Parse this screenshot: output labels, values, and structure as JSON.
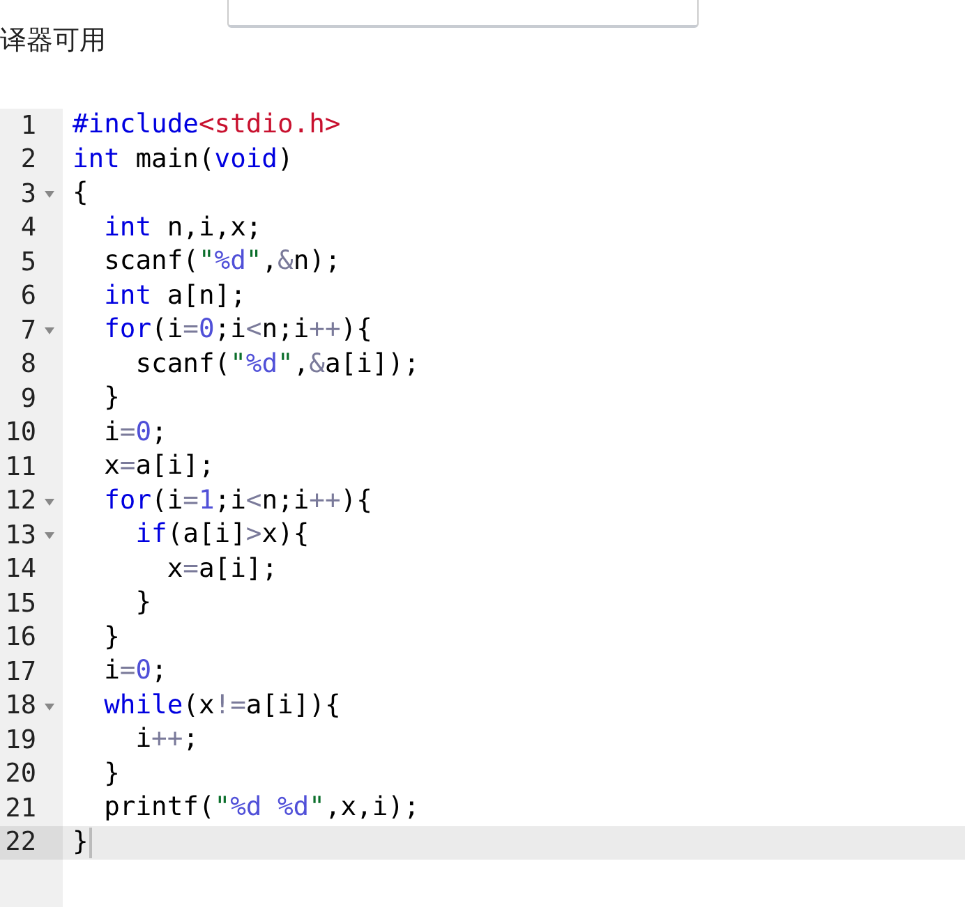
{
  "compiler_note": "译器可用",
  "code_lines": [
    {
      "number": "1",
      "foldable": false,
      "current": false,
      "tokens": [
        {
          "kind": "meta",
          "text": "#include"
        },
        {
          "kind": "header",
          "text": "<stdio.h>"
        }
      ]
    },
    {
      "number": "2",
      "foldable": false,
      "current": false,
      "tokens": [
        {
          "kind": "keyword",
          "text": "int"
        },
        {
          "kind": "plain",
          "text": " main("
        },
        {
          "kind": "keyword",
          "text": "void"
        },
        {
          "kind": "plain",
          "text": ")"
        }
      ]
    },
    {
      "number": "3",
      "foldable": true,
      "current": false,
      "tokens": [
        {
          "kind": "plain",
          "text": "{"
        }
      ]
    },
    {
      "number": "4",
      "foldable": false,
      "current": false,
      "tokens": [
        {
          "kind": "keyword",
          "text": "  int"
        },
        {
          "kind": "plain",
          "text": " n,i,x;"
        }
      ]
    },
    {
      "number": "5",
      "foldable": false,
      "current": false,
      "tokens": [
        {
          "kind": "plain",
          "text": "  scanf("
        },
        {
          "kind": "quote",
          "text": "\""
        },
        {
          "kind": "format",
          "text": "%d"
        },
        {
          "kind": "quote",
          "text": "\""
        },
        {
          "kind": "plain",
          "text": ","
        },
        {
          "kind": "operator",
          "text": "&"
        },
        {
          "kind": "plain",
          "text": "n);"
        }
      ]
    },
    {
      "number": "6",
      "foldable": false,
      "current": false,
      "tokens": [
        {
          "kind": "keyword",
          "text": "  int"
        },
        {
          "kind": "plain",
          "text": " a[n];"
        }
      ]
    },
    {
      "number": "7",
      "foldable": true,
      "current": false,
      "tokens": [
        {
          "kind": "keyword",
          "text": "  for"
        },
        {
          "kind": "plain",
          "text": "(i"
        },
        {
          "kind": "operator",
          "text": "="
        },
        {
          "kind": "number",
          "text": "0"
        },
        {
          "kind": "plain",
          "text": ";i"
        },
        {
          "kind": "operator",
          "text": "<"
        },
        {
          "kind": "plain",
          "text": "n;i"
        },
        {
          "kind": "operator",
          "text": "++"
        },
        {
          "kind": "plain",
          "text": "){"
        }
      ]
    },
    {
      "number": "8",
      "foldable": false,
      "current": false,
      "tokens": [
        {
          "kind": "plain",
          "text": "    scanf("
        },
        {
          "kind": "quote",
          "text": "\""
        },
        {
          "kind": "format",
          "text": "%d"
        },
        {
          "kind": "quote",
          "text": "\""
        },
        {
          "kind": "plain",
          "text": ","
        },
        {
          "kind": "operator",
          "text": "&"
        },
        {
          "kind": "plain",
          "text": "a[i]);"
        }
      ]
    },
    {
      "number": "9",
      "foldable": false,
      "current": false,
      "tokens": [
        {
          "kind": "plain",
          "text": "  }"
        }
      ]
    },
    {
      "number": "10",
      "foldable": false,
      "current": false,
      "tokens": [
        {
          "kind": "plain",
          "text": "  i"
        },
        {
          "kind": "operator",
          "text": "="
        },
        {
          "kind": "number",
          "text": "0"
        },
        {
          "kind": "plain",
          "text": ";"
        }
      ]
    },
    {
      "number": "11",
      "foldable": false,
      "current": false,
      "tokens": [
        {
          "kind": "plain",
          "text": "  x"
        },
        {
          "kind": "operator",
          "text": "="
        },
        {
          "kind": "plain",
          "text": "a[i];"
        }
      ]
    },
    {
      "number": "12",
      "foldable": true,
      "current": false,
      "tokens": [
        {
          "kind": "keyword",
          "text": "  for"
        },
        {
          "kind": "plain",
          "text": "(i"
        },
        {
          "kind": "operator",
          "text": "="
        },
        {
          "kind": "number",
          "text": "1"
        },
        {
          "kind": "plain",
          "text": ";i"
        },
        {
          "kind": "operator",
          "text": "<"
        },
        {
          "kind": "plain",
          "text": "n;i"
        },
        {
          "kind": "operator",
          "text": "++"
        },
        {
          "kind": "plain",
          "text": "){"
        }
      ]
    },
    {
      "number": "13",
      "foldable": true,
      "current": false,
      "tokens": [
        {
          "kind": "keyword",
          "text": "    if"
        },
        {
          "kind": "plain",
          "text": "(a[i]"
        },
        {
          "kind": "operator",
          "text": ">"
        },
        {
          "kind": "plain",
          "text": "x){"
        }
      ]
    },
    {
      "number": "14",
      "foldable": false,
      "current": false,
      "tokens": [
        {
          "kind": "plain",
          "text": "      x"
        },
        {
          "kind": "operator",
          "text": "="
        },
        {
          "kind": "plain",
          "text": "a[i];"
        }
      ]
    },
    {
      "number": "15",
      "foldable": false,
      "current": false,
      "tokens": [
        {
          "kind": "plain",
          "text": "    }"
        }
      ]
    },
    {
      "number": "16",
      "foldable": false,
      "current": false,
      "tokens": [
        {
          "kind": "plain",
          "text": "  }"
        }
      ]
    },
    {
      "number": "17",
      "foldable": false,
      "current": false,
      "tokens": [
        {
          "kind": "plain",
          "text": "  i"
        },
        {
          "kind": "operator",
          "text": "="
        },
        {
          "kind": "number",
          "text": "0"
        },
        {
          "kind": "plain",
          "text": ";"
        }
      ]
    },
    {
      "number": "18",
      "foldable": true,
      "current": false,
      "tokens": [
        {
          "kind": "keyword",
          "text": "  while"
        },
        {
          "kind": "plain",
          "text": "(x"
        },
        {
          "kind": "operator",
          "text": "!="
        },
        {
          "kind": "plain",
          "text": "a[i]){"
        }
      ]
    },
    {
      "number": "19",
      "foldable": false,
      "current": false,
      "tokens": [
        {
          "kind": "plain",
          "text": "    i"
        },
        {
          "kind": "operator",
          "text": "++"
        },
        {
          "kind": "plain",
          "text": ";"
        }
      ]
    },
    {
      "number": "20",
      "foldable": false,
      "current": false,
      "tokens": [
        {
          "kind": "plain",
          "text": "  }"
        }
      ]
    },
    {
      "number": "21",
      "foldable": false,
      "current": false,
      "tokens": [
        {
          "kind": "plain",
          "text": "  printf("
        },
        {
          "kind": "quote",
          "text": "\""
        },
        {
          "kind": "format",
          "text": "%d %d"
        },
        {
          "kind": "quote",
          "text": "\""
        },
        {
          "kind": "plain",
          "text": ",x,i);"
        }
      ]
    },
    {
      "number": "22",
      "foldable": false,
      "current": true,
      "tokens": [
        {
          "kind": "plain",
          "text": "}"
        }
      ]
    }
  ]
}
